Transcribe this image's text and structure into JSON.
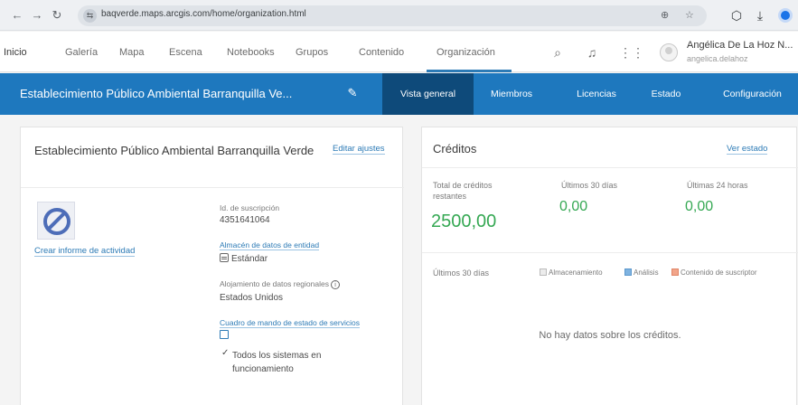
{
  "browser": {
    "url": "baqverde.maps.arcgis.com/home/organization.html"
  },
  "topnav": {
    "items": [
      "Inicio",
      "Galería",
      "Mapa",
      "Escena",
      "Notebooks",
      "Grupos",
      "Contenido",
      "Organización"
    ],
    "active": "Organización",
    "user_name": "Angélica De La Hoz N...",
    "user_login": "angelica.delahoz"
  },
  "org": {
    "title": "Establecimiento Público Ambiental Barranquilla Ve...",
    "tabs": [
      "Vista general",
      "Miembros",
      "Licencias",
      "Estado",
      "Configuración"
    ],
    "active_tab": "Vista general"
  },
  "overview": {
    "title": "Establecimiento Público Ambiental Barranquilla Verde",
    "edit_link": "Editar ajustes",
    "activity_link": "Crear informe de actividad",
    "subscription_label": "Id. de suscripción",
    "subscription_id": "4351641064",
    "feature_storage_link": "Almacén de datos de entidad",
    "feature_storage_value": "Estándar",
    "regional_label": "Alojamiento de datos regionales",
    "regional_value": "Estados Unidos",
    "health_link": "Cuadro de mando de estado de servicios",
    "health_status": "Todos los sistemas en funcionamiento"
  },
  "credits": {
    "title": "Créditos",
    "view_status_link": "Ver estado",
    "remaining_label": "Total de créditos restantes",
    "remaining_value": "2500,00",
    "last30_label": "Últimos 30 días",
    "last30_value": "0,00",
    "last24_label": "Últimas 24 horas",
    "last24_value": "0,00",
    "period_label": "Últimos 30 días",
    "legend": [
      "Almacenamiento",
      "Análisis",
      "Contenido de suscriptor"
    ],
    "legend_colors": [
      "#e0e0e0",
      "#7fb3e0",
      "#f2a58a"
    ],
    "empty_message": "No hay datos sobre los créditos."
  },
  "colors": {
    "brand_blue": "#1e78be",
    "active_tab": "#0e4a7a",
    "credit_green": "#35a853",
    "link_blue": "#2d7bb6"
  }
}
